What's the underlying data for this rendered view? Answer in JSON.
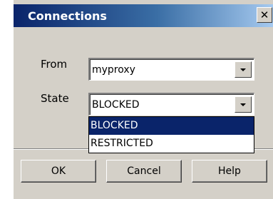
{
  "window": {
    "title": "Connections",
    "close_glyph": "✕",
    "close_icon": "close-icon"
  },
  "form": {
    "from_label": "From",
    "from_value": "myproxy",
    "state_label": "State",
    "state_value": "BLOCKED"
  },
  "dropdown": {
    "options": [
      "BLOCKED",
      "RESTRICTED"
    ],
    "selected_index": 0
  },
  "buttons": {
    "ok": "OK",
    "cancel": "Cancel",
    "help": "Help"
  },
  "colors": {
    "titlebar_start": "#0a246a",
    "titlebar_end": "#a6caf0",
    "dialog_face": "#d4d0c8",
    "selection": "#0a246a"
  }
}
